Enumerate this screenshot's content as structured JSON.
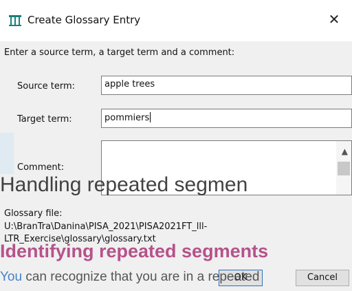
{
  "dialog": {
    "title": "Create Glossary Entry",
    "close_glyph": "✕",
    "instruction": "Enter a source term, a target term and a comment:",
    "source_label": "Source term:",
    "source_value": "apple trees",
    "target_label": "Target term:",
    "target_value": "pommiers",
    "comment_label": "Comment:",
    "comment_value": "",
    "file_label": "Glossary file:",
    "file_path": "U:\\BranTra\\Danina\\PISA_2021\\PISA2021FT_lll-LTR_Exercise\\glossary\\glossary.txt",
    "ok_label": "OK",
    "cancel_label": "Cancel"
  },
  "overlay": {
    "heading": "Handling repeated segmen",
    "subheading": "Identifying repeated segments",
    "para_start": "You",
    "para_rest": " can recognize that you are in a repeated"
  },
  "colors": {
    "accent": "#2a6fc0",
    "subheading": "#b0417f"
  },
  "icons": {
    "app": "omegat-glossary-icon",
    "close": "close-icon",
    "scroll_up": "chevron-up-icon"
  }
}
